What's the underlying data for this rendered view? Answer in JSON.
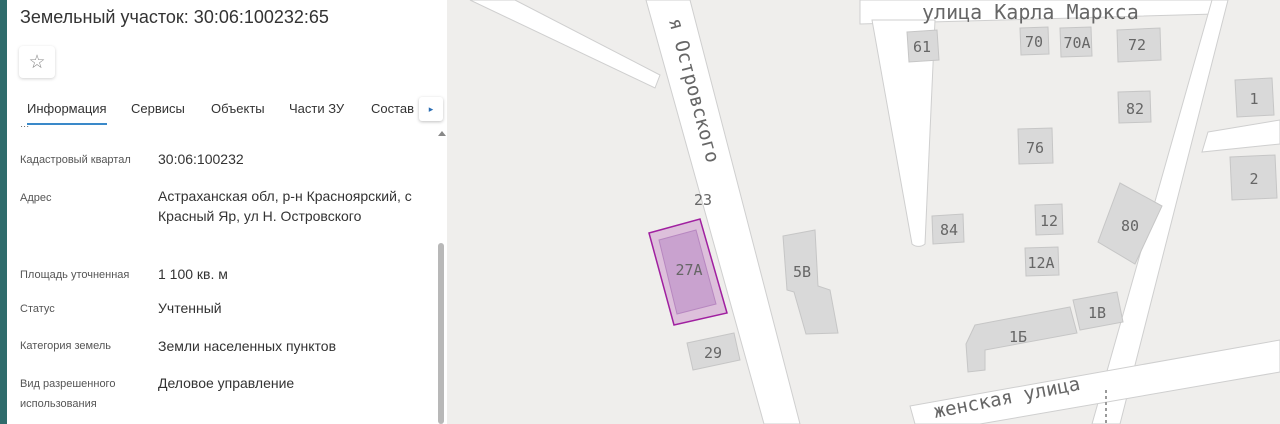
{
  "panel": {
    "title": "Земельный участок: 30:06:100232:65",
    "star_icon": "☆",
    "tabs": [
      "Информация",
      "Сервисы",
      "Объекты",
      "Части ЗУ",
      "Состав"
    ],
    "tabs_next_icon": "▸",
    "cut_row": "...",
    "fields": [
      {
        "label": "Кадастровый квартал",
        "value": "30:06:100232"
      },
      {
        "label": "Адрес",
        "value": "Астраханская обл, р-н Красноярский, с Красный Яр, ул Н. Островского"
      },
      {
        "label": "Площадь уточненная",
        "value": "1 100 кв. м"
      },
      {
        "label": "Статус",
        "value": "Учтенный"
      },
      {
        "label": "Категория земель",
        "value": "Земли населенных пунктов"
      },
      {
        "label": "Вид разрешенного использования",
        "value": "Деловое управление"
      }
    ]
  },
  "map": {
    "streets": {
      "ostrovskogo": "я Островского",
      "marx": "улица Карла Маркса",
      "bottom": "женская улица"
    },
    "houses": [
      "61",
      "70",
      "70А",
      "72",
      "1",
      "82",
      "76",
      "2",
      "23",
      "84",
      "12",
      "80",
      "12А",
      "27А",
      "5В",
      "1Б",
      "1В",
      "29"
    ],
    "parcel_color": "#a020a0"
  }
}
